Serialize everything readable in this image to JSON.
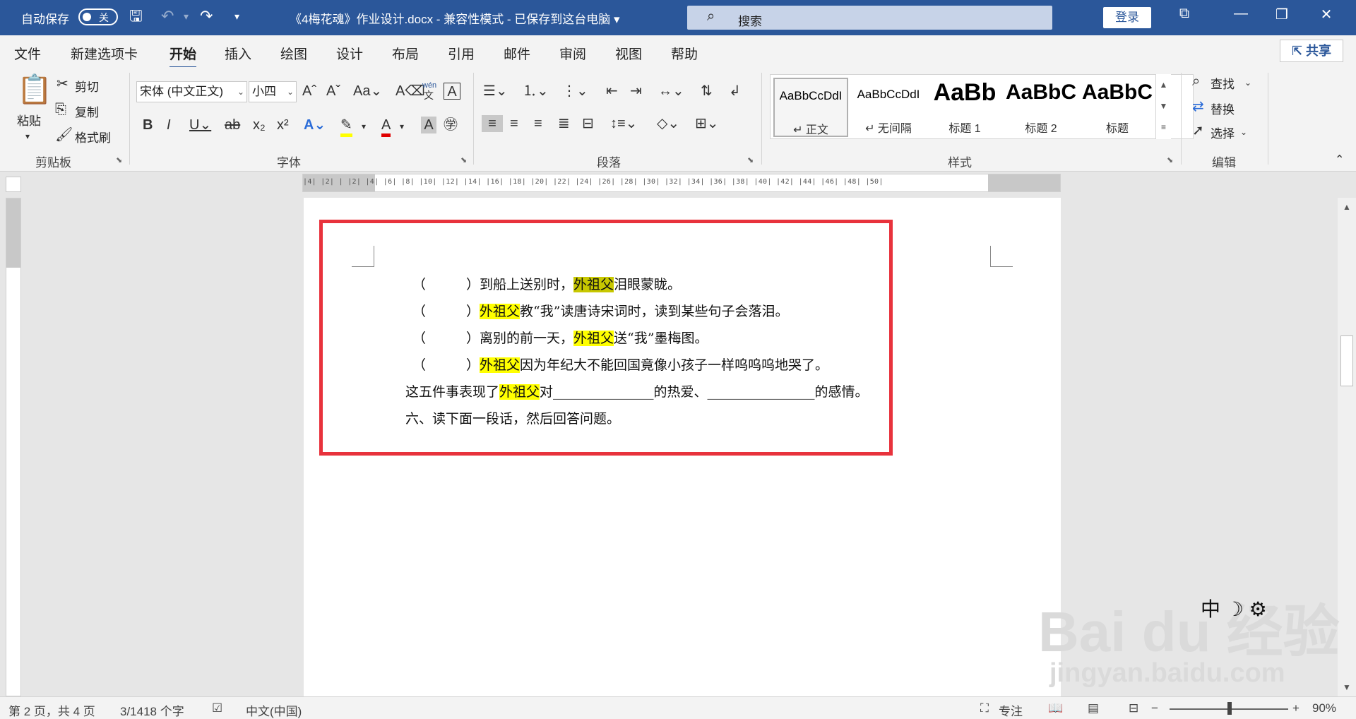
{
  "titlebar": {
    "autosave": "自动保存",
    "toggle_state": "关",
    "doc_title": "《4梅花魂》作业设计.docx  -  兼容性模式  -  已保存到这台电脑  ▾",
    "search_placeholder": "搜索",
    "login": "登录"
  },
  "menu": {
    "tabs": [
      "文件",
      "新建选项卡",
      "开始",
      "插入",
      "绘图",
      "设计",
      "布局",
      "引用",
      "邮件",
      "审阅",
      "视图",
      "帮助"
    ],
    "active_tab": "开始",
    "share": "共享"
  },
  "ribbon": {
    "clipboard": {
      "paste": "粘贴",
      "cut": "剪切",
      "copy": "复制",
      "format_painter": "格式刷",
      "label": "剪贴板"
    },
    "font": {
      "family": "宋体 (中文正文)",
      "size": "小四",
      "label": "字体",
      "phonetic": "wén"
    },
    "paragraph": {
      "label": "段落"
    },
    "styles": {
      "label": "样式",
      "items": [
        {
          "preview": "AaBbCcDdI",
          "name": "↵ 正文"
        },
        {
          "preview": "AaBbCcDdI",
          "name": "↵ 无间隔"
        },
        {
          "preview": "AaBb",
          "name": "标题 1"
        },
        {
          "preview": "AaBbC",
          "name": "标题 2"
        },
        {
          "preview": "AaBbC",
          "name": "标题"
        }
      ]
    },
    "editing": {
      "find": "查找",
      "replace": "替换",
      "select": "选择",
      "label": "编辑"
    }
  },
  "ruler": {
    "ticks": "|4|  |2|  |  |2|  |4|  |6|  |8|  |10|  |12|  |14|  |16|  |18|  |20|  |22|  |24|  |26|  |28|  |30|  |32|  |34|  |36|  |38|  |40|  |42|  |44|  |46|  |48|  |50|"
  },
  "document": {
    "lines": [
      {
        "prefix": "（　　　）到船上送别时，",
        "hl": "外祖父",
        "suffix": "泪眼蒙眬。"
      },
      {
        "prefix": "（　　　）",
        "hl": "外祖父",
        "suffix": "教“我”读唐诗宋词时，读到某些句子会落泪。"
      },
      {
        "prefix": "（　　　）离别的前一天，",
        "hl": "外祖父",
        "suffix": "送“我”墨梅图。"
      },
      {
        "prefix": "（　　　）",
        "hl": "外祖父",
        "suffix": "因为年纪大不能回国竟像小孩子一样呜呜呜地哭了。"
      },
      {
        "prefix": "这五件事表现了",
        "hl": "外祖父",
        "suffix": "对_______________的热爱、________________的感情。"
      },
      {
        "prefix": "六、读下面一段话，然后回答问题。",
        "hl": "",
        "suffix": ""
      }
    ]
  },
  "status": {
    "page": "第 2 页，共 4 页",
    "words": "3/1418 个字",
    "language": "中文(中国)",
    "focus": "专注",
    "zoom": "90%"
  },
  "overlay": {
    "ime": "中 ☽ ⚙",
    "watermark_brand": "Bai du 经验",
    "watermark_url": "jingyan.baidu.com"
  },
  "colors": {
    "titlebar": "#2b579a",
    "highlight": "#ffff00",
    "annotation_box": "#e8323c"
  }
}
